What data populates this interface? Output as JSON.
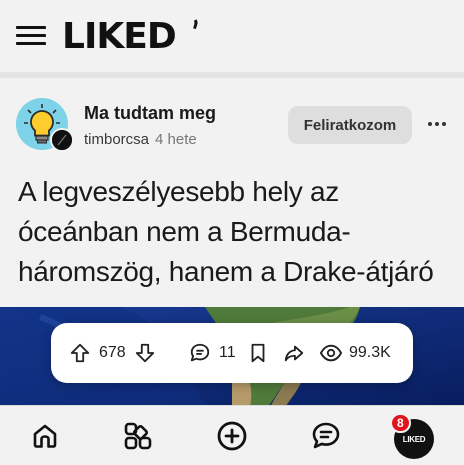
{
  "header": {
    "logo_text": "LIKED",
    "menu_icon": "hamburger-icon"
  },
  "post": {
    "group_name": "Ma tudtam meg",
    "author": "timborcsa",
    "time_ago": "4 hete",
    "subscribe_label": "Feliratkozom",
    "title": "A legveszélyesebb hely az óceánban nem a Bermuda-háromszög, hanem a Drake-átjáró",
    "avatar_icon": "lightbulb-icon",
    "more_icon": "more-horizontal-icon"
  },
  "stats": {
    "upvotes": "678",
    "comments": "11",
    "views": "99.3K",
    "icons": [
      "upvote-icon",
      "downvote-icon",
      "comment-icon",
      "bookmark-icon",
      "share-icon",
      "eye-icon"
    ]
  },
  "bottom_nav": {
    "items": [
      "home-icon",
      "categories-icon",
      "create-post-icon",
      "messages-icon"
    ],
    "profile_label": "LIKED",
    "notification_count": "8"
  },
  "colors": {
    "background": "#f2f2f2",
    "badge": "#e0141e",
    "avatar_bg": "#7fd3e8",
    "ocean": "#0c2a7a"
  }
}
